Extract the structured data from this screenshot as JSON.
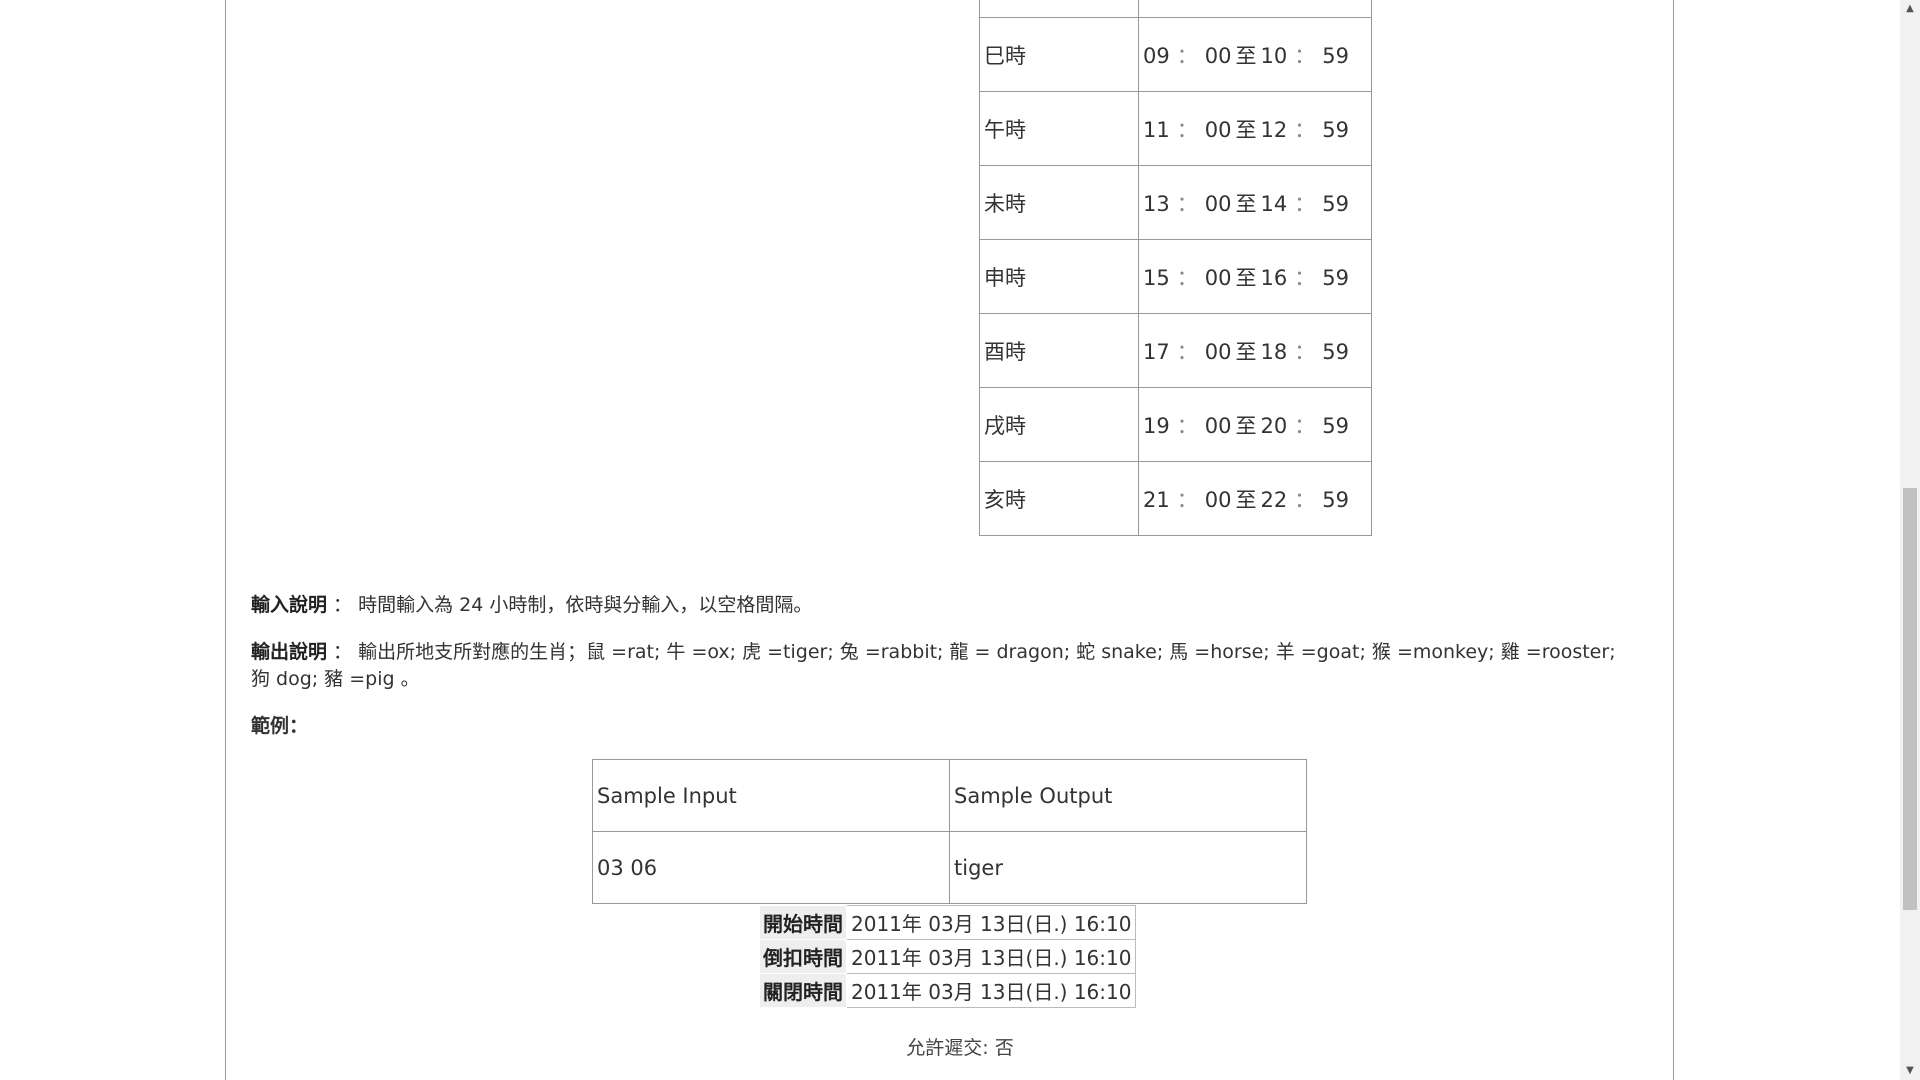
{
  "time_table": {
    "rows": [
      {
        "branch": "巳時",
        "start_h": "09",
        "start_m": "00",
        "to": "至",
        "end_h": "10",
        "end_m": "59"
      },
      {
        "branch": "午時",
        "start_h": "11",
        "start_m": "00",
        "to": "至",
        "end_h": "12",
        "end_m": "59"
      },
      {
        "branch": "未時",
        "start_h": "13",
        "start_m": "00",
        "to": "至",
        "end_h": "14",
        "end_m": "59"
      },
      {
        "branch": "申時",
        "start_h": "15",
        "start_m": "00",
        "to": "至",
        "end_h": "16",
        "end_m": "59"
      },
      {
        "branch": "酉時",
        "start_h": "17",
        "start_m": "00",
        "to": "至",
        "end_h": "18",
        "end_m": "59"
      },
      {
        "branch": "戌時",
        "start_h": "19",
        "start_m": "00",
        "to": "至",
        "end_h": "20",
        "end_m": "59"
      },
      {
        "branch": "亥時",
        "start_h": "21",
        "start_m": "00",
        "to": "至",
        "end_h": "22",
        "end_m": "59"
      }
    ],
    "colon": "："
  },
  "input_desc": {
    "label": "輸入說明",
    "sep": " ： ",
    "text": "時間輸入為 24 小時制，依時與分輸入，以空格間隔。"
  },
  "output_desc": {
    "label": "輸出說明",
    "sep": " ： ",
    "text": "輸出所地支所對應的生肖；鼠 =rat; 牛 =ox; 虎 =tiger; 兔 =rabbit; 龍 = dragon; 蛇 snake; 馬 =horse; 羊 =goat; 猴 =monkey; 雞 =rooster; 狗 dog; 豬 =pig 。"
  },
  "example_label": "範例：",
  "sample": {
    "input_header": "Sample Input",
    "output_header": "Sample Output",
    "input_value": "03 06",
    "output_value": "tiger"
  },
  "times": {
    "start_label": "開始時間",
    "start_value": "2011年 03月 13日(日.) 16:10",
    "deduct_label": "倒扣時間",
    "deduct_value": "2011年 03月 13日(日.) 16:10",
    "close_label": "關閉時間",
    "close_value": "2011年 03月 13日(日.) 16:10"
  },
  "late_submit": "允許遲交: 否",
  "scrollbar": {
    "position_fraction": 0.45,
    "up_icon": "triangle-up",
    "down_icon": "triangle-down"
  }
}
